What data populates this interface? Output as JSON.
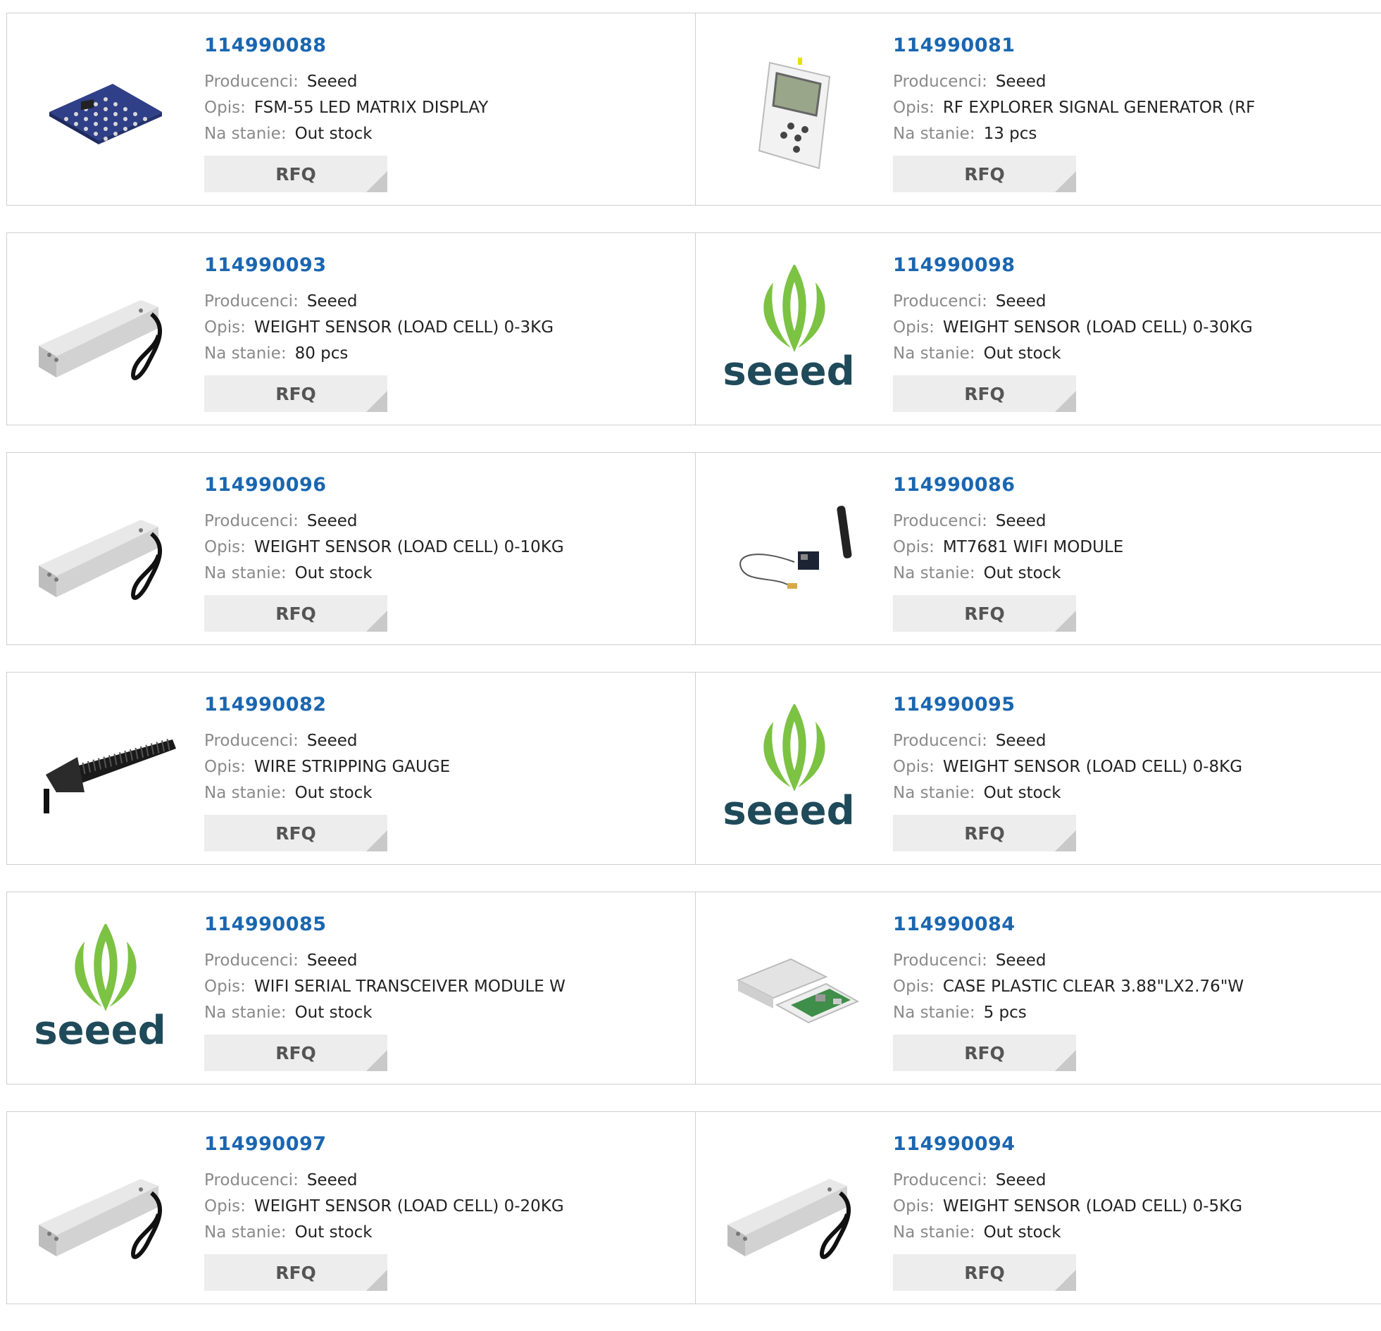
{
  "labels": {
    "manufacturer": "Producenci:",
    "description": "Opis:",
    "stock": "Na stanie:",
    "rfq": "RFQ"
  },
  "products": [
    {
      "pn": "114990088",
      "manufacturer": "Seeed",
      "description": "FSM-55 LED MATRIX DISPLAY",
      "stock": "Out stock",
      "image": "led-matrix-board"
    },
    {
      "pn": "114990081",
      "manufacturer": "Seeed",
      "description": "RF EXPLORER SIGNAL GENERATOR (RF",
      "stock": "13 pcs",
      "image": "handheld-device"
    },
    {
      "pn": "114990093",
      "manufacturer": "Seeed",
      "description": "WEIGHT SENSOR (LOAD CELL) 0-3KG",
      "stock": "80 pcs",
      "image": "load-cell"
    },
    {
      "pn": "114990098",
      "manufacturer": "Seeed",
      "description": "WEIGHT SENSOR (LOAD CELL) 0-30KG",
      "stock": "Out stock",
      "image": "seeed-logo"
    },
    {
      "pn": "114990096",
      "manufacturer": "Seeed",
      "description": "WEIGHT SENSOR (LOAD CELL) 0-10KG",
      "stock": "Out stock",
      "image": "load-cell"
    },
    {
      "pn": "114990086",
      "manufacturer": "Seeed",
      "description": "MT7681 WIFI MODULE",
      "stock": "Out stock",
      "image": "wifi-module"
    },
    {
      "pn": "114990082",
      "manufacturer": "Seeed",
      "description": "WIRE STRIPPING GAUGE",
      "stock": "Out stock",
      "image": "wire-gauge"
    },
    {
      "pn": "114990095",
      "manufacturer": "Seeed",
      "description": "WEIGHT SENSOR (LOAD CELL) 0-8KG",
      "stock": "Out stock",
      "image": "seeed-logo"
    },
    {
      "pn": "114990085",
      "manufacturer": "Seeed",
      "description": "WIFI SERIAL TRANSCEIVER MODULE W",
      "stock": "Out stock",
      "image": "seeed-logo"
    },
    {
      "pn": "114990084",
      "manufacturer": "Seeed",
      "description": "CASE PLASTIC CLEAR 3.88\"LX2.76\"W",
      "stock": "5 pcs",
      "image": "case-board"
    },
    {
      "pn": "114990097",
      "manufacturer": "Seeed",
      "description": "WEIGHT SENSOR (LOAD CELL) 0-20KG",
      "stock": "Out stock",
      "image": "load-cell"
    },
    {
      "pn": "114990094",
      "manufacturer": "Seeed",
      "description": "WEIGHT SENSOR (LOAD CELL) 0-5KG",
      "stock": "Out stock",
      "image": "load-cell"
    }
  ]
}
